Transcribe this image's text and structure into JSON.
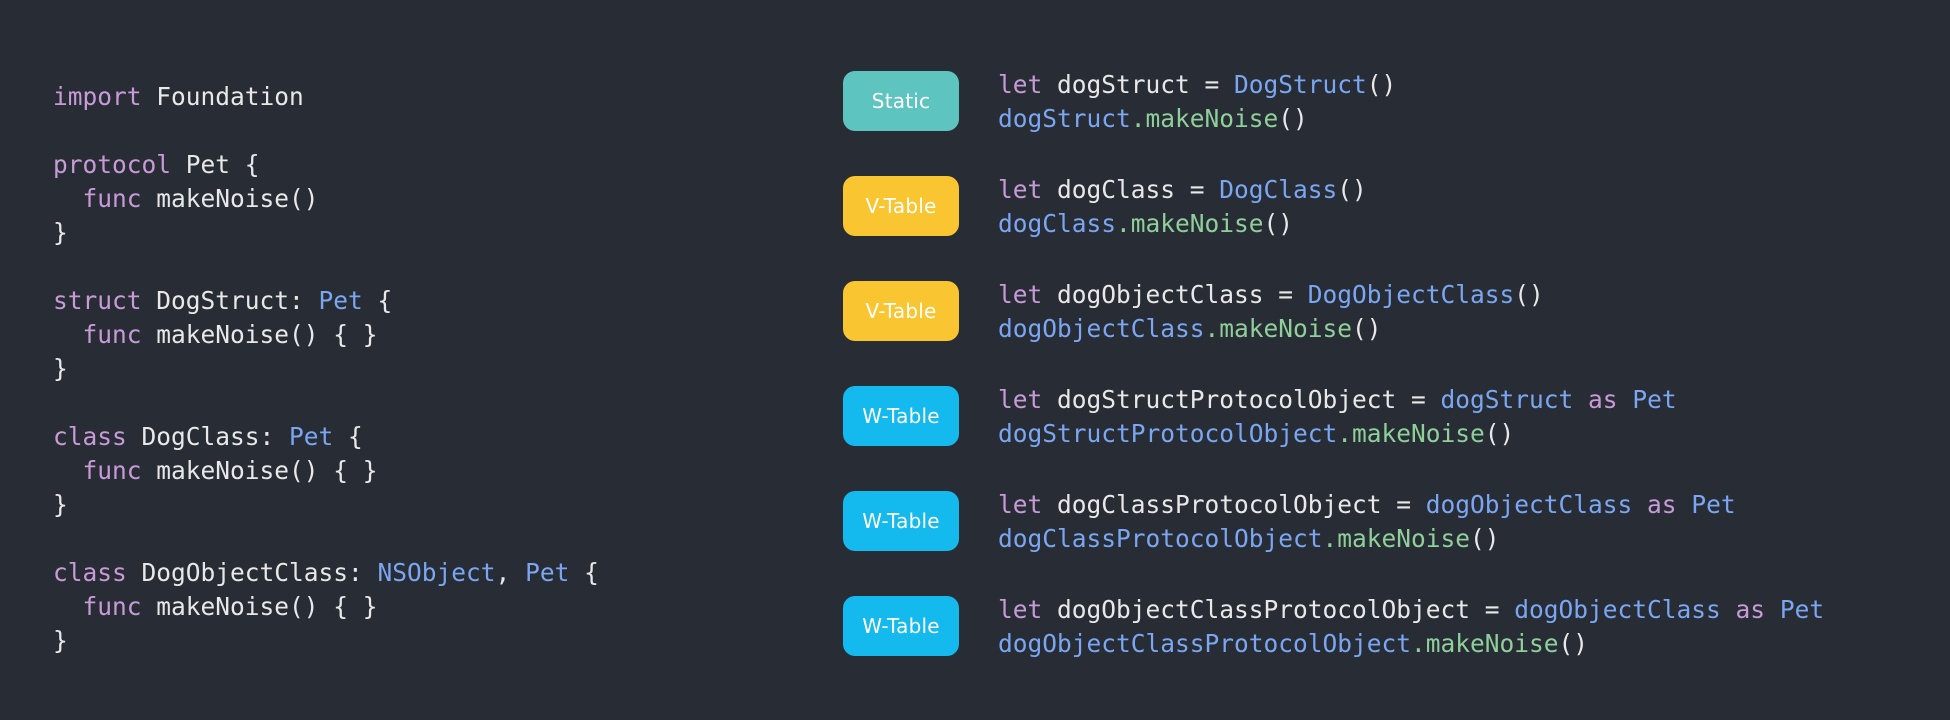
{
  "colors": {
    "background": "#282d35",
    "keyword": "#c89ad8",
    "type": "#7aa6f2",
    "method": "#8fcf9a",
    "text": "#e8e8e8",
    "badge_static": "#5ec4c0",
    "badge_vtable": "#f9c531",
    "badge_wtable": "#14b9ee"
  },
  "left_code": [
    [
      {
        "t": "import",
        "c": "kw"
      },
      {
        "t": " Foundation",
        "c": "txt"
      }
    ],
    [],
    [
      {
        "t": "protocol",
        "c": "kw"
      },
      {
        "t": " Pet {",
        "c": "txt"
      }
    ],
    [
      {
        "t": "  ",
        "c": "txt"
      },
      {
        "t": "func",
        "c": "kw"
      },
      {
        "t": " makeNoise()",
        "c": "txt"
      }
    ],
    [
      {
        "t": "}",
        "c": "txt"
      }
    ],
    [],
    [
      {
        "t": "struct",
        "c": "kw"
      },
      {
        "t": " DogStruct: ",
        "c": "txt"
      },
      {
        "t": "Pet",
        "c": "typ"
      },
      {
        "t": " {",
        "c": "txt"
      }
    ],
    [
      {
        "t": "  ",
        "c": "txt"
      },
      {
        "t": "func",
        "c": "kw"
      },
      {
        "t": " makeNoise() { }",
        "c": "txt"
      }
    ],
    [
      {
        "t": "}",
        "c": "txt"
      }
    ],
    [],
    [
      {
        "t": "class",
        "c": "kw"
      },
      {
        "t": " DogClass: ",
        "c": "txt"
      },
      {
        "t": "Pet",
        "c": "typ"
      },
      {
        "t": " {",
        "c": "txt"
      }
    ],
    [
      {
        "t": "  ",
        "c": "txt"
      },
      {
        "t": "func",
        "c": "kw"
      },
      {
        "t": " makeNoise() { }",
        "c": "txt"
      }
    ],
    [
      {
        "t": "}",
        "c": "txt"
      }
    ],
    [],
    [
      {
        "t": "class",
        "c": "kw"
      },
      {
        "t": " DogObjectClass: ",
        "c": "txt"
      },
      {
        "t": "NSObject",
        "c": "typ"
      },
      {
        "t": ", ",
        "c": "txt"
      },
      {
        "t": "Pet",
        "c": "typ"
      },
      {
        "t": " {",
        "c": "txt"
      }
    ],
    [
      {
        "t": "  ",
        "c": "txt"
      },
      {
        "t": "func",
        "c": "kw"
      },
      {
        "t": " makeNoise() { }",
        "c": "txt"
      }
    ],
    [
      {
        "t": "}",
        "c": "txt"
      }
    ]
  ],
  "dispatch_rows": [
    {
      "badge": "Static",
      "kind": "static",
      "lines": [
        [
          {
            "t": "let",
            "c": "kw"
          },
          {
            "t": " dogStruct = ",
            "c": "txt"
          },
          {
            "t": "DogStruct",
            "c": "typ"
          },
          {
            "t": "()",
            "c": "txt"
          }
        ],
        [
          {
            "t": "dogStruct",
            "c": "typ"
          },
          {
            "t": ".makeNoise",
            "c": "mth"
          },
          {
            "t": "()",
            "c": "txt"
          }
        ]
      ]
    },
    {
      "badge": "V-Table",
      "kind": "vtable",
      "lines": [
        [
          {
            "t": "let",
            "c": "kw"
          },
          {
            "t": " dogClass = ",
            "c": "txt"
          },
          {
            "t": "DogClass",
            "c": "typ"
          },
          {
            "t": "()",
            "c": "txt"
          }
        ],
        [
          {
            "t": "dogClass",
            "c": "typ"
          },
          {
            "t": ".makeNoise",
            "c": "mth"
          },
          {
            "t": "()",
            "c": "txt"
          }
        ]
      ]
    },
    {
      "badge": "V-Table",
      "kind": "vtable",
      "lines": [
        [
          {
            "t": "let",
            "c": "kw"
          },
          {
            "t": " dogObjectClass = ",
            "c": "txt"
          },
          {
            "t": "DogObjectClass",
            "c": "typ"
          },
          {
            "t": "()",
            "c": "txt"
          }
        ],
        [
          {
            "t": "dogObjectClass",
            "c": "typ"
          },
          {
            "t": ".makeNoise",
            "c": "mth"
          },
          {
            "t": "()",
            "c": "txt"
          }
        ]
      ]
    },
    {
      "badge": "W-Table",
      "kind": "wtable",
      "lines": [
        [
          {
            "t": "let",
            "c": "kw"
          },
          {
            "t": " dogStructProtocolObject = ",
            "c": "txt"
          },
          {
            "t": "dogStruct",
            "c": "typ"
          },
          {
            "t": " as",
            "c": "kw"
          },
          {
            "t": " Pet",
            "c": "typ"
          }
        ],
        [
          {
            "t": "dogStructProtocolObject",
            "c": "typ"
          },
          {
            "t": ".makeNoise",
            "c": "mth"
          },
          {
            "t": "()",
            "c": "txt"
          }
        ]
      ]
    },
    {
      "badge": "W-Table",
      "kind": "wtable",
      "lines": [
        [
          {
            "t": "let",
            "c": "kw"
          },
          {
            "t": " dogClassProtocolObject = ",
            "c": "txt"
          },
          {
            "t": "dogObjectClass",
            "c": "typ"
          },
          {
            "t": " as",
            "c": "kw"
          },
          {
            "t": " Pet",
            "c": "typ"
          }
        ],
        [
          {
            "t": "dogClassProtocolObject",
            "c": "typ"
          },
          {
            "t": ".makeNoise",
            "c": "mth"
          },
          {
            "t": "()",
            "c": "txt"
          }
        ]
      ]
    },
    {
      "badge": "W-Table",
      "kind": "wtable",
      "lines": [
        [
          {
            "t": "let",
            "c": "kw"
          },
          {
            "t": " dogObjectClassProtocolObject = ",
            "c": "txt"
          },
          {
            "t": "dogObjectClass",
            "c": "typ"
          },
          {
            "t": " as",
            "c": "kw"
          },
          {
            "t": " Pet",
            "c": "typ"
          }
        ],
        [
          {
            "t": "dogObjectClassProtocolObject",
            "c": "typ"
          },
          {
            "t": ".makeNoise",
            "c": "mth"
          },
          {
            "t": "()",
            "c": "txt"
          }
        ]
      ]
    }
  ]
}
